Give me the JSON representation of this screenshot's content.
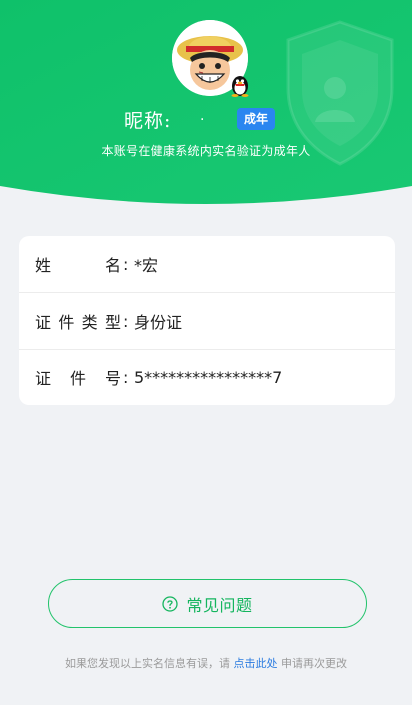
{
  "header": {
    "nickname_label": "昵称:",
    "nickname_value": ".",
    "adult_badge": "成年",
    "verify_note": "本账号在健康系统内实名验证为成年人"
  },
  "colors": {
    "header_green": "#12c36a",
    "badge_blue": "#2a86f0",
    "accent_green": "#14b55e",
    "link_blue": "#2a7be0"
  },
  "info": {
    "rows": [
      {
        "label_chars": [
          "姓",
          "名"
        ],
        "colon": ":",
        "value": "*宏"
      },
      {
        "label_chars": [
          "证",
          "件",
          "类",
          "型"
        ],
        "colon": ":",
        "value": "身份证"
      },
      {
        "label_chars": [
          "证",
          "件",
          "号"
        ],
        "colon": ":",
        "value": "5****************7"
      }
    ]
  },
  "faq": {
    "icon": "question-circle-icon",
    "label": "常见问题"
  },
  "footer": {
    "prefix": "如果您发现以上实名信息有误，请",
    "link": "点击此处",
    "suffix": "申请再次更改"
  }
}
